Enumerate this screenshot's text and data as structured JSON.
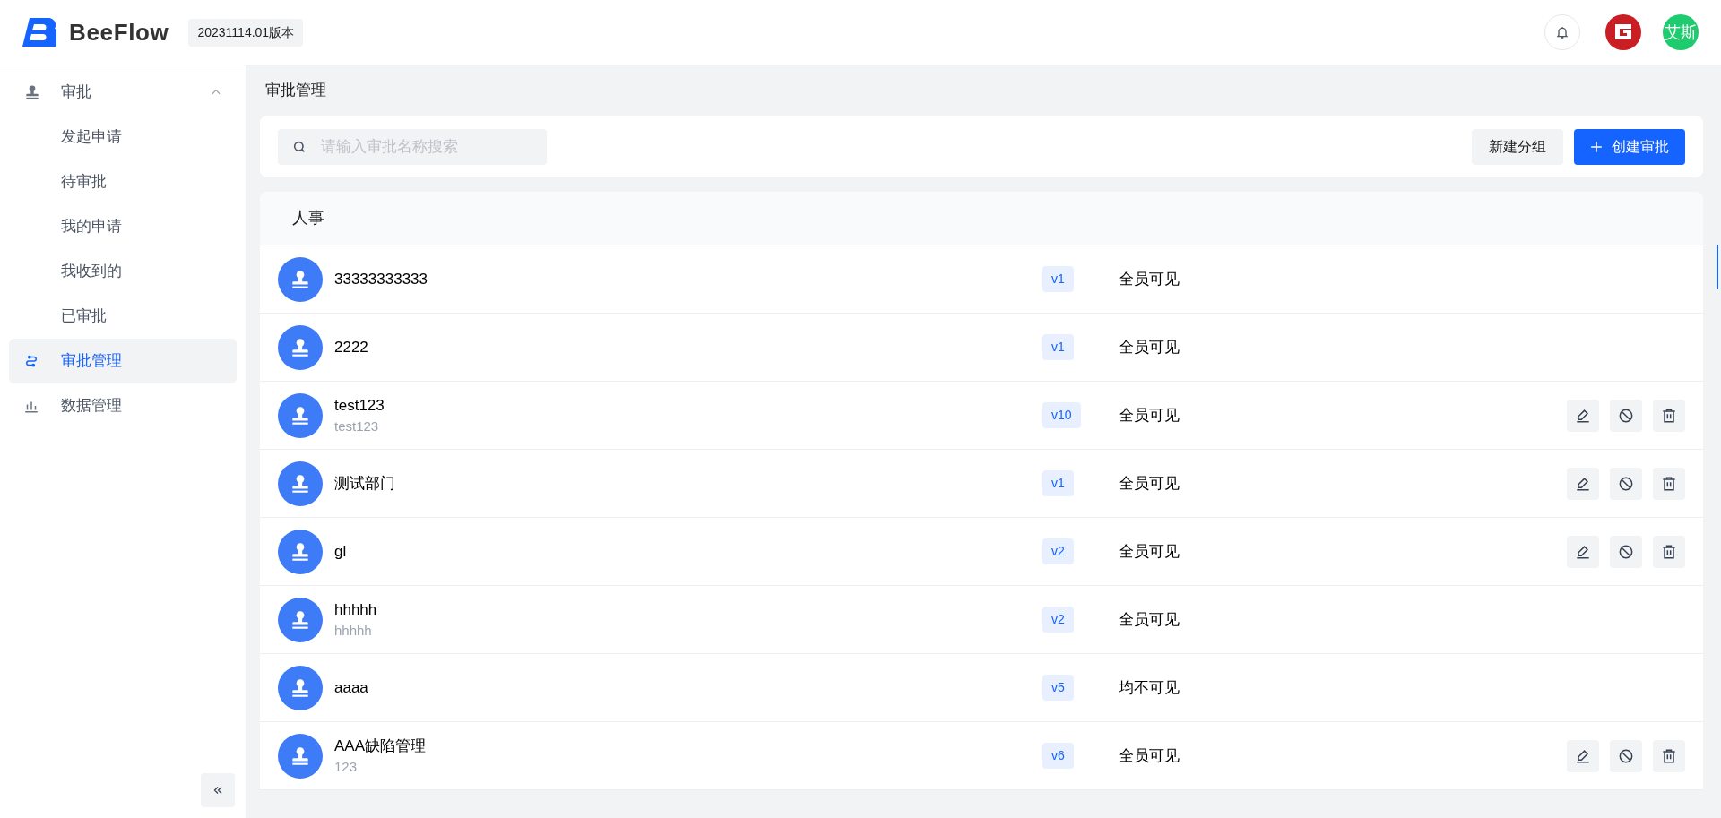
{
  "header": {
    "logo_text": "BeeFlow",
    "version": "20231114.01版本",
    "user_avatar": "艾斯"
  },
  "sidebar": {
    "items": [
      {
        "label": "审批",
        "expanded": true,
        "selected": false,
        "children": [
          {
            "label": "发起申请",
            "selected": false
          },
          {
            "label": "待审批",
            "selected": false
          },
          {
            "label": "我的申请",
            "selected": false
          },
          {
            "label": "我收到的",
            "selected": false
          },
          {
            "label": "已审批",
            "selected": false
          }
        ]
      },
      {
        "label": "审批管理",
        "selected": true
      },
      {
        "label": "数据管理",
        "selected": false
      }
    ]
  },
  "breadcrumb": "审批管理",
  "toolbar": {
    "search": {
      "placeholder": "请输入审批名称搜索"
    },
    "buttons": [
      {
        "label": "新建分组",
        "kind": "secondary"
      },
      {
        "label": "创建审批",
        "kind": "primary"
      }
    ]
  },
  "group": {
    "title": "人事",
    "rows": [
      {
        "name": "33333333333",
        "version": "v1",
        "visibility": "全员可见",
        "editable": false
      },
      {
        "name": "2222",
        "version": "v1",
        "visibility": "全员可见",
        "editable": false
      },
      {
        "name": "test123",
        "subtitle": "test123",
        "version": "v10",
        "visibility": "全员可见",
        "editable": true
      },
      {
        "name": "测试部门",
        "version": "v1",
        "visibility": "全员可见",
        "editable": true
      },
      {
        "name": "gl",
        "version": "v2",
        "visibility": "全员可见",
        "editable": true
      },
      {
        "name": "hhhhh",
        "subtitle": "hhhhh",
        "version": "v2",
        "visibility": "全员可见",
        "editable": false
      },
      {
        "name": "aaaa",
        "version": "v5",
        "visibility": "均不可见",
        "editable": false
      },
      {
        "name": "AAA缺陷管理",
        "subtitle": "123",
        "version": "v6",
        "visibility": "全员可见",
        "editable": true
      }
    ]
  }
}
